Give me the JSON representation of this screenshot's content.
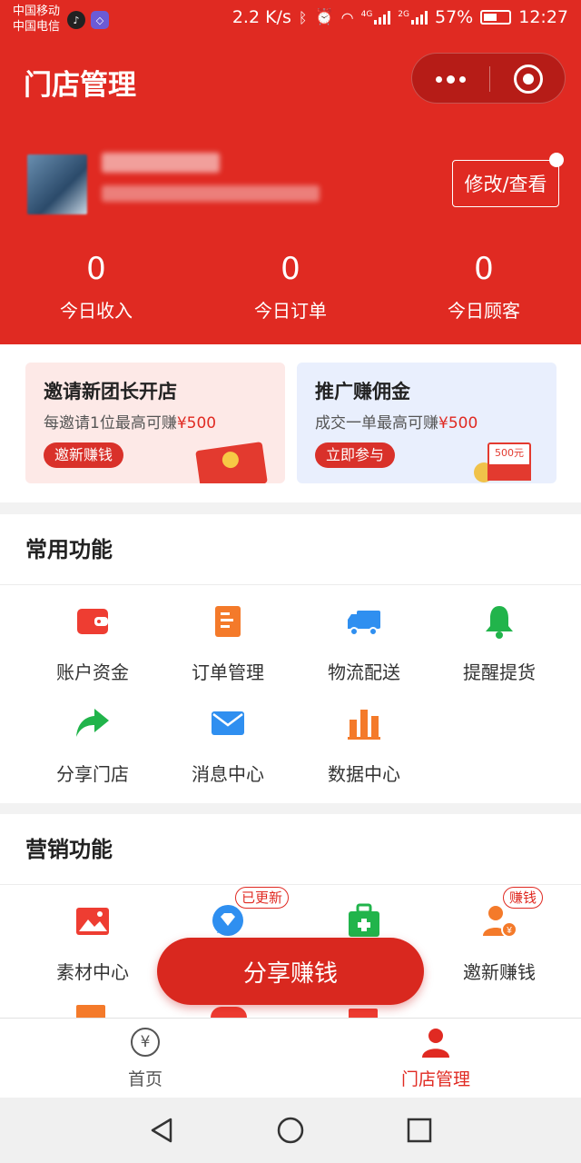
{
  "status_bar": {
    "carrier1": "中国移动",
    "carrier2": "中国电信",
    "speed": "2.2 K/s",
    "net4g": "4G",
    "net2g": "2G",
    "battery": "57%",
    "time": "12:27"
  },
  "header": {
    "title": "门店管理",
    "edit_label": "修改/查看",
    "stats": [
      {
        "value": "0",
        "label": "今日收入"
      },
      {
        "value": "0",
        "label": "今日订单"
      },
      {
        "value": "0",
        "label": "今日顾客"
      }
    ]
  },
  "promos": [
    {
      "title": "邀请新团长开店",
      "subtitle_prefix": "每邀请1位最高可赚",
      "amount": "¥500",
      "button": "邀新赚钱"
    },
    {
      "title": "推广赚佣金",
      "subtitle_prefix": "成交一单最高可赚",
      "amount": "¥500",
      "button": "立即参与",
      "cheque_label": "500元"
    }
  ],
  "common": {
    "title": "常用功能",
    "items": [
      {
        "label": "账户资金",
        "icon": "wallet-icon"
      },
      {
        "label": "订单管理",
        "icon": "order-icon"
      },
      {
        "label": "物流配送",
        "icon": "truck-icon"
      },
      {
        "label": "提醒提货",
        "icon": "bell-icon"
      },
      {
        "label": "分享门店",
        "icon": "share-icon"
      },
      {
        "label": "消息中心",
        "icon": "mail-icon"
      },
      {
        "label": "数据中心",
        "icon": "bar-chart-icon"
      }
    ]
  },
  "marketing": {
    "title": "营销功能",
    "items": [
      {
        "label": "素材中心",
        "icon": "image-icon"
      },
      {
        "label": "",
        "icon": "diamond-chat-icon",
        "badge": "已更新"
      },
      {
        "label": "",
        "icon": "medkit-icon"
      },
      {
        "label": "邀新赚钱",
        "icon": "user-money-icon",
        "badge": "赚钱"
      }
    ]
  },
  "float_button": "分享赚钱",
  "tabbar": {
    "home": "首页",
    "home_icon_glyph": "¥",
    "store": "门店管理"
  },
  "colors": {
    "brand_red": "#e02a22",
    "icon_orange": "#f47a2a",
    "icon_blue": "#2f8ff0",
    "icon_green": "#21b44b"
  }
}
